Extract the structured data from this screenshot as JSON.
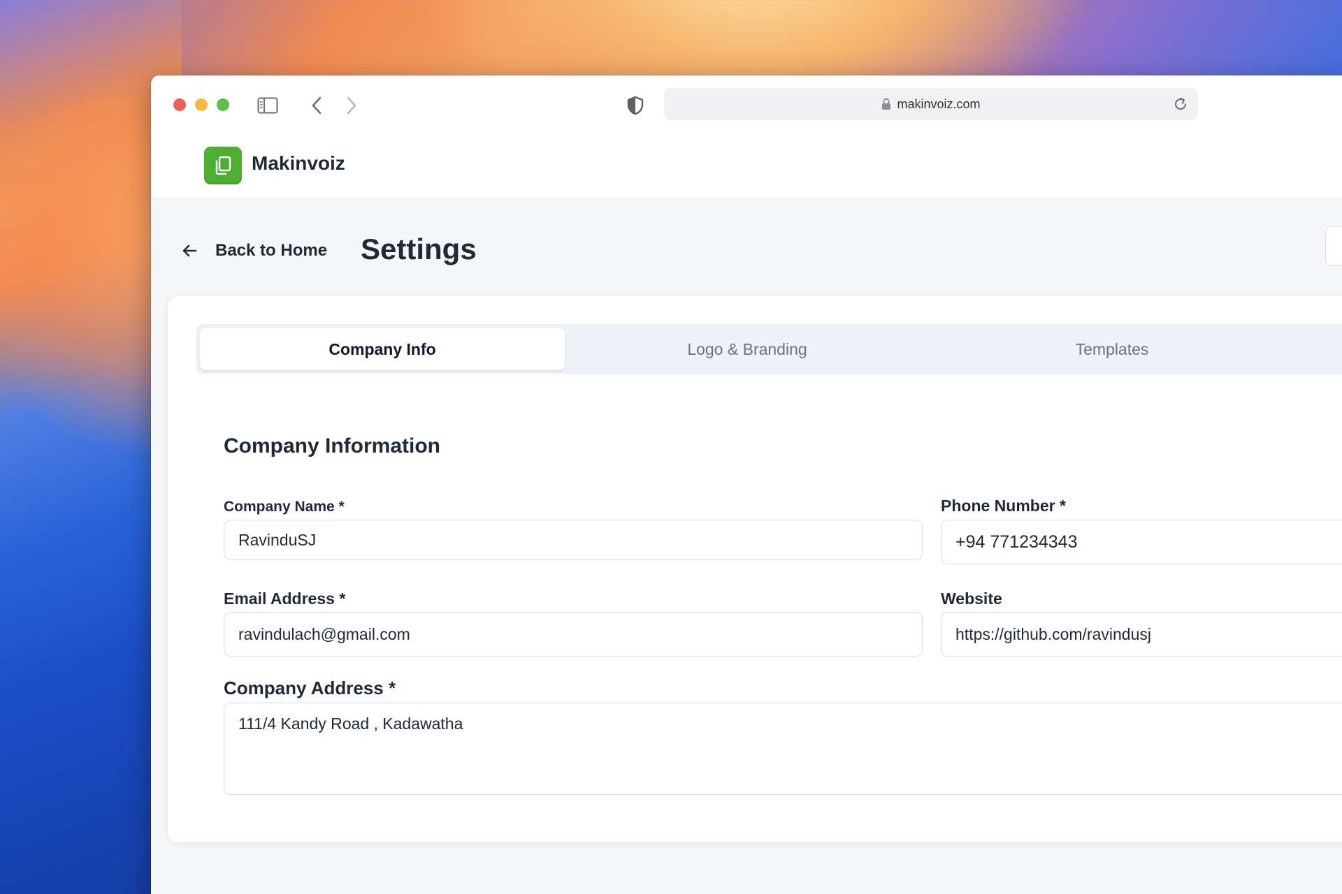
{
  "browser": {
    "url": "makinvoiz.com"
  },
  "app": {
    "brand": "Makinvoiz"
  },
  "page": {
    "back_label": "Back to Home",
    "title": "Settings"
  },
  "tabs": [
    {
      "label": "Company Info",
      "active": true
    },
    {
      "label": "Logo & Branding",
      "active": false
    },
    {
      "label": "Templates",
      "active": false
    }
  ],
  "form": {
    "section_title": "Company Information",
    "company_name": {
      "label": "Company Name *",
      "value": "RavinduSJ"
    },
    "phone": {
      "label": "Phone Number *",
      "value": "+94 771234343"
    },
    "email": {
      "label": "Email Address *",
      "value": "ravindulach@gmail.com"
    },
    "website": {
      "label": "Website",
      "value": "https://github.com/ravindusj"
    },
    "address": {
      "label": "Company Address *",
      "value": "111/4 Kandy Road , Kadawatha"
    }
  },
  "colors": {
    "brand_green": "#4caf32",
    "traffic_red": "#ec5f57",
    "traffic_yellow": "#f2b93b",
    "traffic_green": "#5cbf4b"
  },
  "icons": [
    "sidebar-toggle-icon",
    "chevron-left-icon",
    "chevron-right-icon",
    "shield-icon",
    "lock-icon",
    "reload-icon",
    "document-copy-icon",
    "arrow-left-icon"
  ]
}
